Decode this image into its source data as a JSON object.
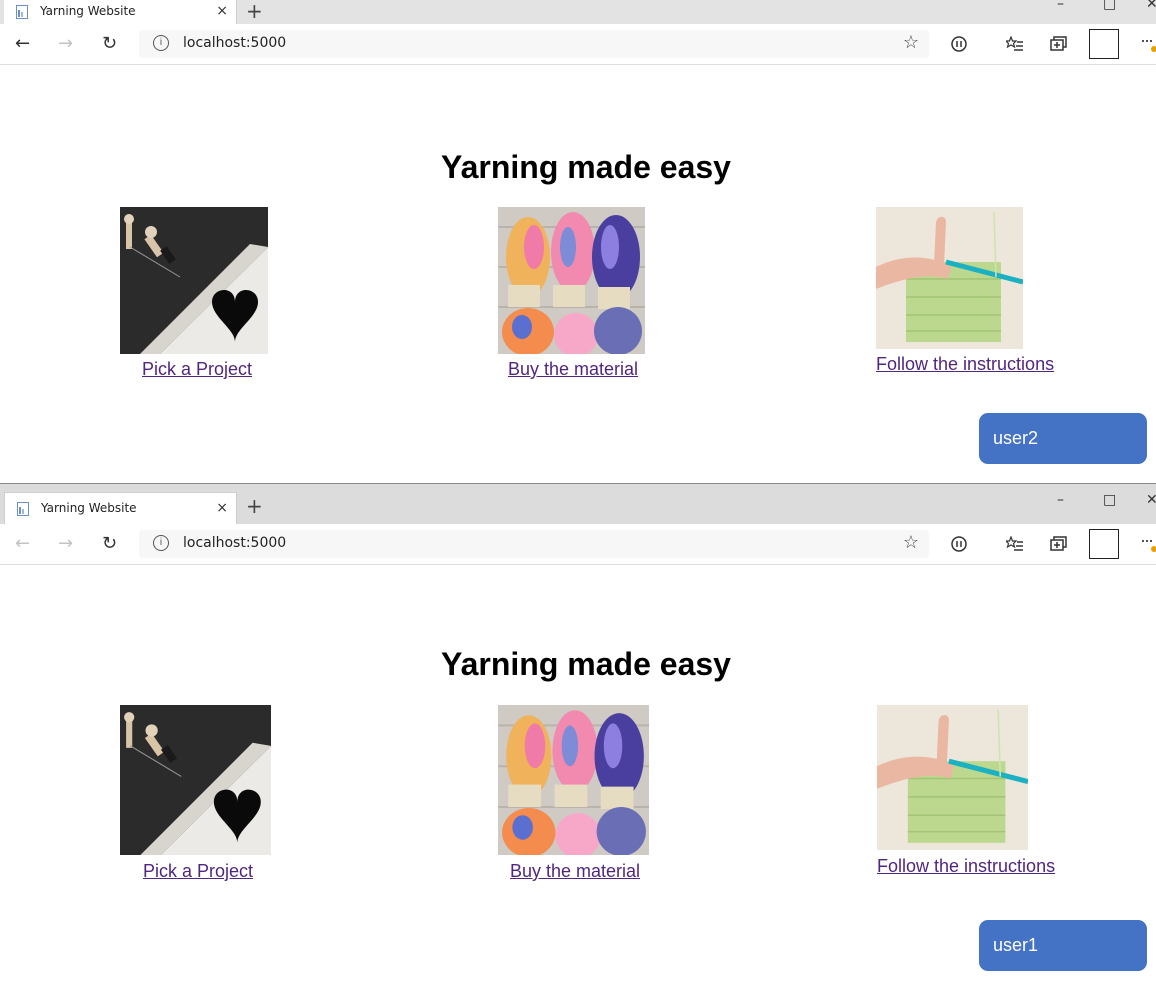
{
  "windows": [
    {
      "tab_title": "Yarning Website",
      "url": "localhost:5000",
      "heading": "Yarning made easy",
      "cards": [
        {
          "link": "Pick a Project"
        },
        {
          "link": "Buy the material"
        },
        {
          "link": "Follow the instructions"
        }
      ],
      "user_button": "user2"
    },
    {
      "tab_title": "Yarning Website",
      "url": "localhost:5000",
      "heading": "Yarning made easy",
      "cards": [
        {
          "link": "Pick a Project"
        },
        {
          "link": "Buy the material"
        },
        {
          "link": "Follow the instructions"
        }
      ],
      "user_button": "user1"
    }
  ],
  "icons": {
    "tab_close": "×",
    "new_tab": "+",
    "back": "←",
    "forward": "→",
    "refresh": "↻",
    "info": "i",
    "favorite": "☆",
    "minimize": "–",
    "maximize": "□",
    "close": "✕",
    "more": "···"
  },
  "colors": {
    "user_button": "#4472c4",
    "link": "#51267f"
  }
}
